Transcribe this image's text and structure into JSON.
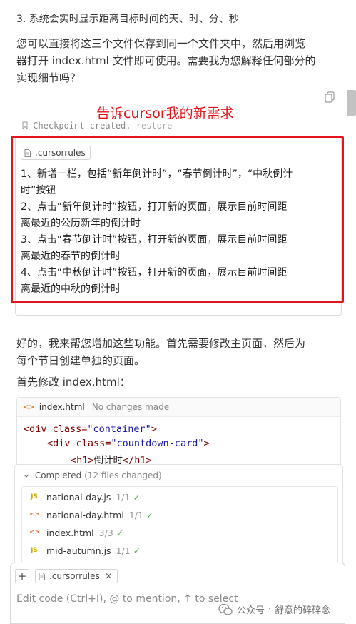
{
  "top_item": "3. 系统会实时显示距离目标时间的天、时、分、秒",
  "intro_lines": [
    "您可以直接将这三个文件保存到同一个文件夹中，然后用浏览",
    "器打开 index.html 文件即可使用。需要我为您解释任何部分的",
    "实现细节吗？"
  ],
  "annotation": "告诉cursor我的新需求",
  "checkpoint": {
    "text": "Checkpoint created.",
    "restore": "restore"
  },
  "user_message": {
    "chip": ".cursorrules",
    "lines": [
      "1、新增一栏，包括“新年倒计时”，“春节倒计时”，“中秋倒计",
      "时”按钮",
      "2、点击“新年倒计时”按钮，打开新的页面，展示目前时间距",
      "离最近的公历新年的倒计时",
      "3、点击“春节倒计时”按钮，打开新的页面，展示目前时间距",
      "离最近的春节的倒计时",
      "4、点击“中秋倒计时”按钮，打开新的页面，展示目前时间距",
      "离最近的中秋的倒计时"
    ]
  },
  "reply_lines": [
    "好的，我来帮您增加这些功能。首先需要修改主页面，然后为",
    "每个节日创建单独的页面。"
  ],
  "first_modify": "首先修改 index.html：",
  "code_panel": {
    "filename": "index.html",
    "status": "No changes made",
    "line1": {
      "open": "<div class=",
      "value": "\"container\"",
      "close": ">"
    },
    "line2": {
      "open": "<div class=",
      "value": "\"countdown-card\"",
      "close": ">"
    },
    "line3": {
      "open": "<h1>",
      "text": "倒计时",
      "close": "</h1>"
    }
  },
  "completed": {
    "label": "Completed",
    "count": "(12 files changed)",
    "files": [
      {
        "icon": "JS",
        "name": "national-day.js",
        "ratio": "1/1"
      },
      {
        "icon": "<>",
        "name": "national-day.html",
        "ratio": "1/1"
      },
      {
        "icon": "<>",
        "name": "index.html",
        "ratio": "3/3"
      },
      {
        "icon": "JS",
        "name": "mid-autumn.js",
        "ratio": "1/1"
      }
    ]
  },
  "input": {
    "chip": ".cursorrules",
    "chip_close": "×",
    "plus": "+",
    "placeholder": "Edit code (Ctrl+I), @ to mention, ↑ to select"
  },
  "watermark": {
    "prefix": "公众号",
    "separator": "·",
    "name": "舒意的碎碎念"
  },
  "colors": {
    "accent_red": "#e4141b",
    "check_green": "#5bb15b",
    "html_orange": "#e37933",
    "js_yellow": "#c9b000"
  }
}
